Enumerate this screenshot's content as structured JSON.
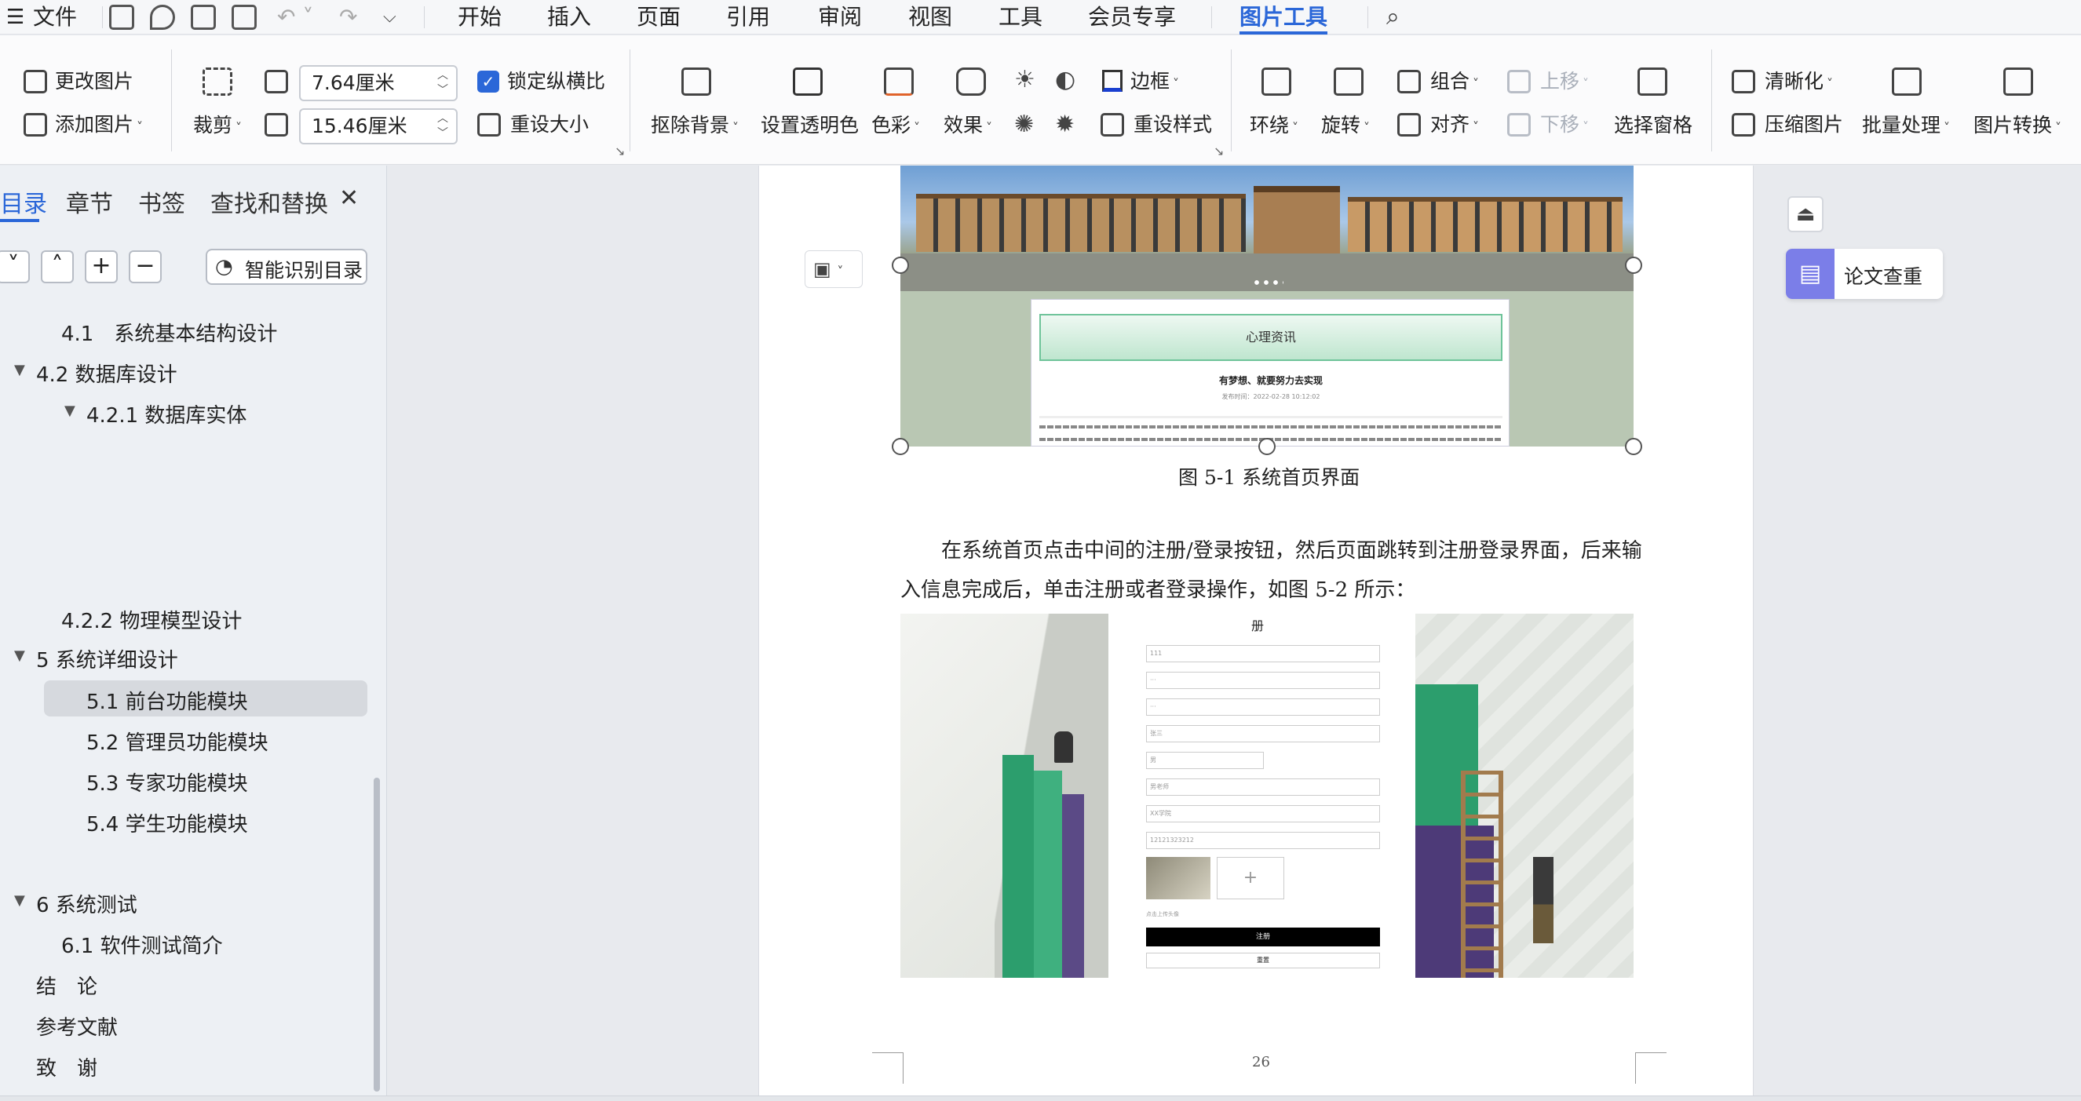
{
  "menubar": {
    "file_label": "文件",
    "tabs": [
      "开始",
      "插入",
      "页面",
      "引用",
      "审阅",
      "视图",
      "工具",
      "会员专享",
      "图片工具"
    ]
  },
  "ribbon": {
    "change_pic": "更改图片",
    "add_pic": "添加图片",
    "crop": "裁剪",
    "width": "7.64厘米",
    "height": "15.46厘米",
    "lock_ratio": "锁定纵横比",
    "reset_size": "重设大小",
    "remove_bg": "抠除背景",
    "set_transparent": "设置透明色",
    "color": "色彩",
    "effects": "效果",
    "border": "边框",
    "reset_style": "重设样式",
    "wrap": "环绕",
    "rotate": "旋转",
    "group": "组合",
    "align": "对齐",
    "bring_up": "上移",
    "send_down": "下移",
    "selection_pane": "选择窗格",
    "sharpen": "清晰化",
    "compress": "压缩图片",
    "batch": "批量处理",
    "convert": "图片转换"
  },
  "nav": {
    "tabs": [
      "目录",
      "章节",
      "书签",
      "查找和替换"
    ],
    "smart_toc": "智能识别目录",
    "items": [
      {
        "label": "4.1　系统基本结构设计"
      },
      {
        "label": "4.2 数据库设计"
      },
      {
        "label": "4.2.1 数据库实体"
      },
      {
        "label": "4.2.2 物理模型设计"
      },
      {
        "label": "5 系统详细设计"
      },
      {
        "label": "5.1 前台功能模块"
      },
      {
        "label": "5.2 管理员功能模块"
      },
      {
        "label": "5.3 专家功能模块"
      },
      {
        "label": "5.4 学生功能模块"
      },
      {
        "label": "6 系统测试"
      },
      {
        "label": "6.1 软件测试简介"
      },
      {
        "label": "结　论"
      },
      {
        "label": "参考文献"
      },
      {
        "label": "致　谢"
      }
    ]
  },
  "doc": {
    "shot1_banner": "心理资讯",
    "shot1_headline": "有梦想、就要努力去实现",
    "shot1_meta": "发布时间：2022-02-28 10:12:02",
    "figure_caption": "图 5-1  系统首页界面",
    "para_line1": "在系统首页点击中间的注册/登录按钮，然后页面跳转到注册登录界面，后来输",
    "para_line2": "入信息完成后，单击注册或者登录操作，如图 5-2 所示：",
    "form_title": "册",
    "form_fields": [
      "111",
      "···",
      "···",
      "张三",
      "男",
      "男老师",
      "XX学院",
      "12121323212"
    ],
    "register_btn": "注册",
    "reset_btn": "重置",
    "upload_hint": "点击上传头像",
    "page_number": "26"
  },
  "side": {
    "check_paper": "论文查重"
  }
}
